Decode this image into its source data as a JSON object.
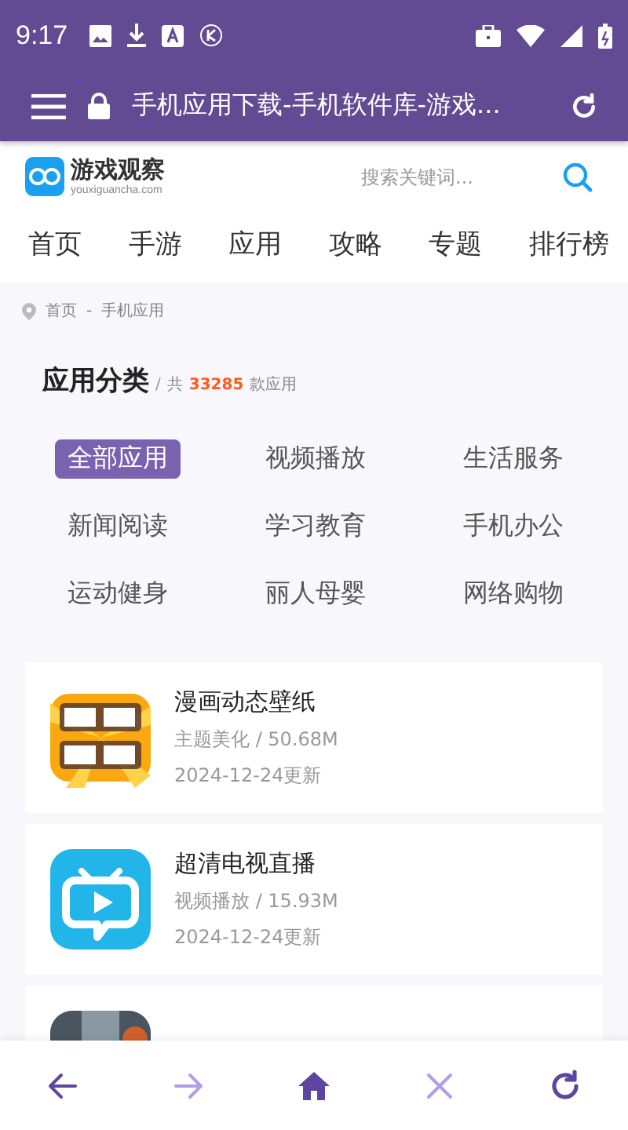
{
  "status_bar": {
    "time": "9:17"
  },
  "toolbar": {
    "title": "手机应用下载-手机软件库-游戏..."
  },
  "site_header": {
    "logo_name": "游戏观察",
    "logo_domain": "youxiguancha.com",
    "search": {
      "placeholder": "搜索关键词..."
    }
  },
  "nav": [
    {
      "label": "首页"
    },
    {
      "label": "手游"
    },
    {
      "label": "应用"
    },
    {
      "label": "攻略"
    },
    {
      "label": "专题"
    },
    {
      "label": "排行榜"
    }
  ],
  "breadcrumb": [
    "首页",
    "-",
    "手机应用"
  ],
  "section": {
    "title": "应用分类",
    "sep": "/",
    "prefix": "共",
    "count": "33285",
    "suffix": "款应用"
  },
  "categories": [
    {
      "label": "全部应用",
      "selected": true
    },
    {
      "label": "视频播放",
      "selected": false
    },
    {
      "label": "生活服务",
      "selected": false
    },
    {
      "label": "新闻阅读",
      "selected": false
    },
    {
      "label": "学习教育",
      "selected": false
    },
    {
      "label": "手机办公",
      "selected": false
    },
    {
      "label": "运动健身",
      "selected": false
    },
    {
      "label": "丽人母婴",
      "selected": false
    },
    {
      "label": "网络购物",
      "selected": false
    }
  ],
  "apps": [
    {
      "kind": "comic",
      "name": "漫画动态壁纸",
      "meta": "主题美化 / 50.68M",
      "date": "2024-12-24更新"
    },
    {
      "kind": "tv",
      "name": "超清电视直播",
      "meta": "视频播放 / 15.93M",
      "date": "2024-12-24更新"
    },
    {
      "kind": "picture"
    }
  ],
  "bottom_nav": [
    {
      "kind": "back",
      "disabled": false
    },
    {
      "kind": "forward",
      "disabled": true
    },
    {
      "kind": "home",
      "disabled": false
    },
    {
      "kind": "close",
      "disabled": true
    },
    {
      "kind": "reload",
      "disabled": false
    }
  ]
}
